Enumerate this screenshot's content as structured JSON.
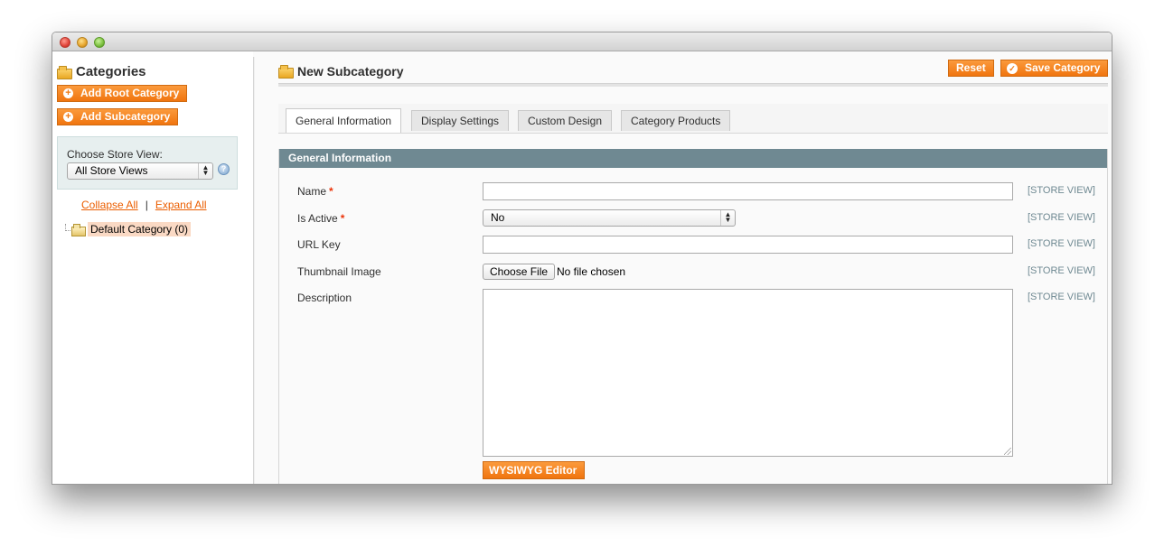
{
  "sidebar": {
    "title": "Categories",
    "add_root_label": "Add Root Category",
    "add_sub_label": "Add Subcategory",
    "store_view_label": "Choose Store View:",
    "store_view_value": "All Store Views",
    "collapse_all": "Collapse All",
    "separator": "|",
    "expand_all": "Expand All",
    "tree": [
      {
        "label": "Default Category (0)"
      }
    ]
  },
  "main": {
    "title": "New Subcategory",
    "reset_label": "Reset",
    "save_label": "Save Category",
    "tabs": [
      {
        "label": "General Information",
        "active": true
      },
      {
        "label": "Display Settings",
        "active": false
      },
      {
        "label": "Custom Design",
        "active": false
      },
      {
        "label": "Category Products",
        "active": false
      }
    ],
    "section_title": "General Information",
    "fields": {
      "name": {
        "label": "Name",
        "required_mark": "*",
        "value": "",
        "scope": "[STORE VIEW]"
      },
      "is_active": {
        "label": "Is Active",
        "required_mark": "*",
        "value": "No",
        "scope": "[STORE VIEW]"
      },
      "url_key": {
        "label": "URL Key",
        "value": "",
        "scope": "[STORE VIEW]"
      },
      "thumbnail": {
        "label": "Thumbnail Image",
        "button_label": "Choose File",
        "status": "No file chosen",
        "scope": "[STORE VIEW]"
      },
      "description": {
        "label": "Description",
        "value": "",
        "scope": "[STORE VIEW]"
      }
    },
    "wysiwyg_label": "WYSIWYG Editor"
  },
  "colors": {
    "accent_orange": "#f0750f",
    "section_header": "#6f8992",
    "link_orange": "#eb5e00"
  }
}
